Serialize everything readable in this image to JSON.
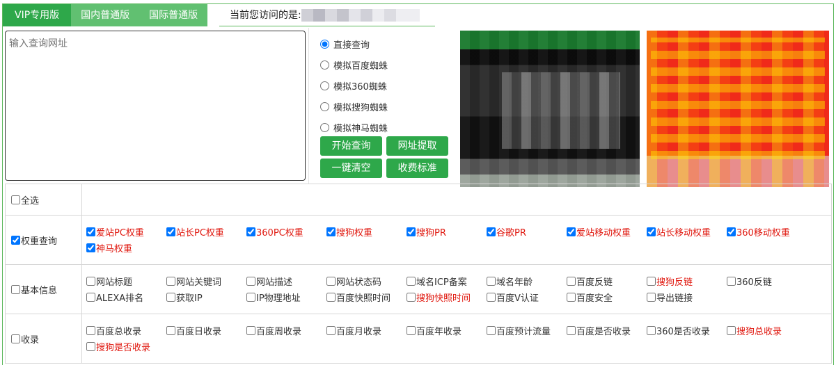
{
  "tabs": [
    {
      "label": "VIP专用版",
      "active": true
    },
    {
      "label": "国内普通版",
      "active": false
    },
    {
      "label": "国际普通版",
      "active": false
    }
  ],
  "visit": {
    "label": "当前您访问的是:"
  },
  "url_input": {
    "placeholder": "输入查询网址"
  },
  "modes": [
    {
      "label": "直接查询",
      "checked": true
    },
    {
      "label": "模拟百度蜘蛛",
      "checked": false
    },
    {
      "label": "模拟360蜘蛛",
      "checked": false
    },
    {
      "label": "模拟搜狗蜘蛛",
      "checked": false
    },
    {
      "label": "模拟神马蜘蛛",
      "checked": false
    }
  ],
  "buttons": {
    "start": "开始查询",
    "extract": "网址提取",
    "clear": "一键清空",
    "pricing": "收费标准"
  },
  "select_all": {
    "label": "全选",
    "checked": false
  },
  "groups": [
    {
      "label": "权重查询",
      "checked": true,
      "items": [
        {
          "label": "爱站PC权重",
          "checked": true,
          "red": true
        },
        {
          "label": "站长PC权重",
          "checked": true,
          "red": true
        },
        {
          "label": "360PC权重",
          "checked": true,
          "red": true
        },
        {
          "label": "搜狗权重",
          "checked": true,
          "red": true
        },
        {
          "label": "搜狗PR",
          "checked": true,
          "red": true
        },
        {
          "label": "谷歌PR",
          "checked": true,
          "red": true
        },
        {
          "label": "爱站移动权重",
          "checked": true,
          "red": true
        },
        {
          "label": "站长移动权重",
          "checked": true,
          "red": true
        },
        {
          "label": "360移动权重",
          "checked": true,
          "red": true
        },
        {
          "label": "神马权重",
          "checked": true,
          "red": true
        }
      ]
    },
    {
      "label": "基本信息",
      "checked": false,
      "items": [
        {
          "label": "网站标题",
          "checked": false,
          "red": false
        },
        {
          "label": "网站关键词",
          "checked": false,
          "red": false
        },
        {
          "label": "网站描述",
          "checked": false,
          "red": false
        },
        {
          "label": "网站状态码",
          "checked": false,
          "red": false
        },
        {
          "label": "域名ICP备案",
          "checked": false,
          "red": false
        },
        {
          "label": "域名年龄",
          "checked": false,
          "red": false
        },
        {
          "label": "百度反链",
          "checked": false,
          "red": false
        },
        {
          "label": "搜狗反链",
          "checked": false,
          "red": true
        },
        {
          "label": "360反链",
          "checked": false,
          "red": false
        },
        {
          "label": "ALEXA排名",
          "checked": false,
          "red": false
        },
        {
          "label": "获取IP",
          "checked": false,
          "red": false
        },
        {
          "label": "IP物理地址",
          "checked": false,
          "red": false
        },
        {
          "label": "百度快照时间",
          "checked": false,
          "red": false
        },
        {
          "label": "搜狗快照时间",
          "checked": false,
          "red": true
        },
        {
          "label": "百度V认证",
          "checked": false,
          "red": false
        },
        {
          "label": "百度安全",
          "checked": false,
          "red": false
        },
        {
          "label": "导出链接",
          "checked": false,
          "red": false
        }
      ]
    },
    {
      "label": "收录",
      "checked": false,
      "items": [
        {
          "label": "百度总收录",
          "checked": false,
          "red": false
        },
        {
          "label": "百度日收录",
          "checked": false,
          "red": false
        },
        {
          "label": "百度周收录",
          "checked": false,
          "red": false
        },
        {
          "label": "百度月收录",
          "checked": false,
          "red": false
        },
        {
          "label": "百度年收录",
          "checked": false,
          "red": false
        },
        {
          "label": "百度预计流量",
          "checked": false,
          "red": false
        },
        {
          "label": "百度是否收录",
          "checked": false,
          "red": false
        },
        {
          "label": "360是否收录",
          "checked": false,
          "red": false
        },
        {
          "label": "搜狗总收录",
          "checked": false,
          "red": true
        },
        {
          "label": "搜狗是否收录",
          "checked": false,
          "red": true
        }
      ]
    }
  ],
  "colors": {
    "accent": "#2ea84a",
    "tab_normal": "#61c071",
    "red_text": "#e0180f",
    "border": "#5cb85c"
  }
}
